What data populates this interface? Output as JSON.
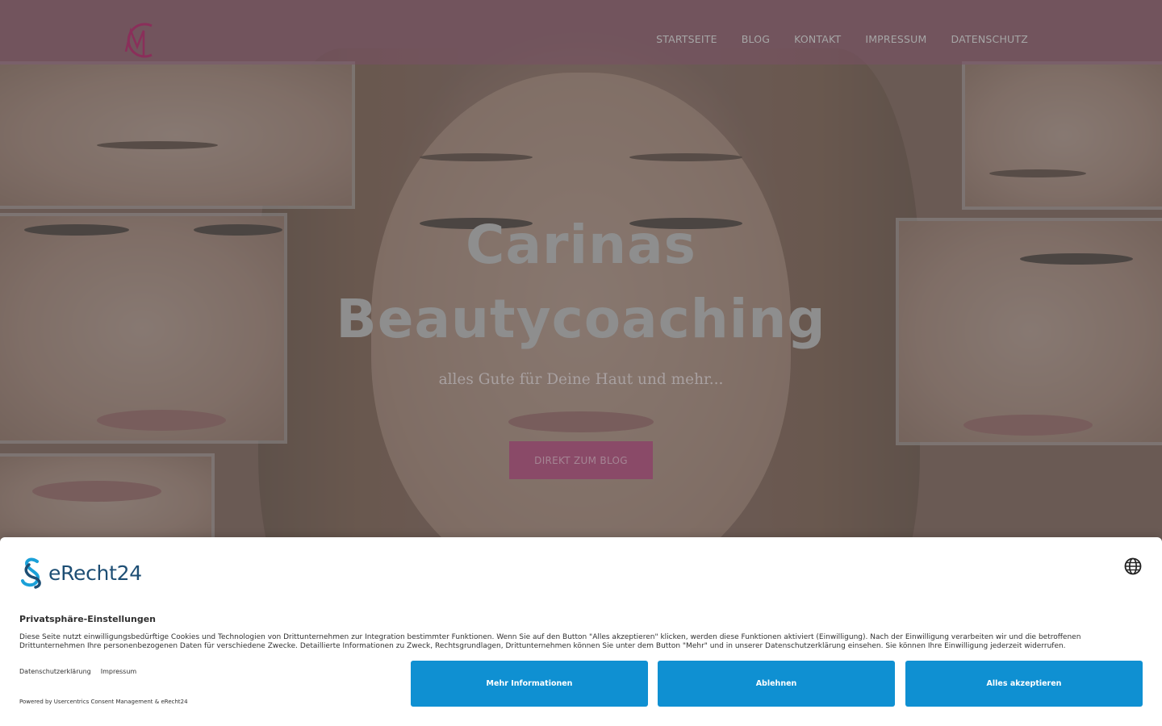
{
  "header": {
    "nav": [
      "STARTSEITE",
      "BLOG",
      "KONTAKT",
      "IMPRESSUM",
      "DATENSCHUTZ"
    ]
  },
  "hero": {
    "title_line1": "Carinas",
    "title_line2": "Beautycoaching",
    "subtitle": "alles Gute für Deine Haut und mehr...",
    "cta": "DIREKT ZUM BLOG"
  },
  "consent": {
    "brand": "eRecht24",
    "title": "Privatsphäre-Einstellungen",
    "text": "Diese Seite nutzt einwilligungsbedürftige Cookies und Technologien von Drittunternehmen zur Integration bestimmter Funktionen. Wenn Sie auf den Button \"Alles akzeptieren\" klicken, werden diese Funktionen aktiviert (Einwilligung). Nach der Einwilligung verarbeiten wir und die betroffenen Drittunternehmen Ihre personenbezogenen Daten für verschiedene Zwecke. Detaillierte Informationen zu Zweck, Rechtsgrundlagen, Drittunternehmen können Sie unter dem Button \"Mehr\" und in unserer Datenschutzerklärung einsehen. Sie können Ihre Einwilligung jederzeit widerrufen.",
    "link_privacy": "Datenschutzerklärung",
    "link_imprint": "Impressum",
    "powered": "Powered by Usercentrics Consent Management & eRecht24",
    "btn_more": "Mehr Informationen",
    "btn_deny": "Ablehnen",
    "btn_accept": "Alles akzeptieren"
  },
  "colors": {
    "accent_pink": "#8a4a68",
    "consent_button": "#0f90d2",
    "brand_blue": "#1d4e74",
    "brand_cyan": "#1aa0d8"
  },
  "icons": {
    "logo": "cm-monogram-logo",
    "language": "globe-icon",
    "brand_mark": "paragraph-section-icon"
  }
}
